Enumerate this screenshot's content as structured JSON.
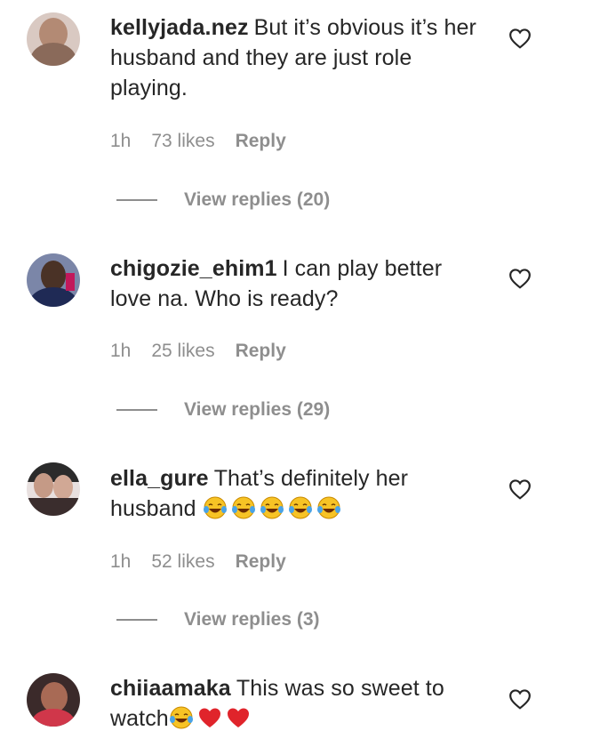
{
  "comments": [
    {
      "username": "kellyjada.nez",
      "text": "But it’s obvious it’s her husband and they are just role playing.",
      "emoji": [],
      "time": "1h",
      "likes": "73 likes",
      "reply_label": "Reply",
      "replies_label": "View replies (20)"
    },
    {
      "username": "chigozie_ehim1",
      "text": "I can play better love na. Who is ready?",
      "emoji": [],
      "time": "1h",
      "likes": "25 likes",
      "reply_label": "Reply",
      "replies_label": "View replies (29)"
    },
    {
      "username": "ella_gure",
      "text": "That’s definitely her husband",
      "emoji": [
        "face-with-tears-of-joy",
        "face-with-tears-of-joy",
        "face-with-tears-of-joy",
        "face-with-tears-of-joy",
        "face-with-tears-of-joy"
      ],
      "time": "1h",
      "likes": "52 likes",
      "reply_label": "Reply",
      "replies_label": "View replies (3)"
    },
    {
      "username": "chiiaamaka",
      "text": "This was so sweet to watch",
      "emoji": [
        "face-with-tears-of-joy",
        "red-heart",
        "red-heart"
      ],
      "time": "",
      "likes": "",
      "reply_label": "",
      "replies_label": ""
    }
  ],
  "icons": {
    "like": "heart-outline-icon",
    "laugh": "face-with-tears-of-joy",
    "heart": "red-heart"
  },
  "colors": {
    "text": "#262626",
    "secondary": "#8e8e8e",
    "background": "#ffffff"
  }
}
